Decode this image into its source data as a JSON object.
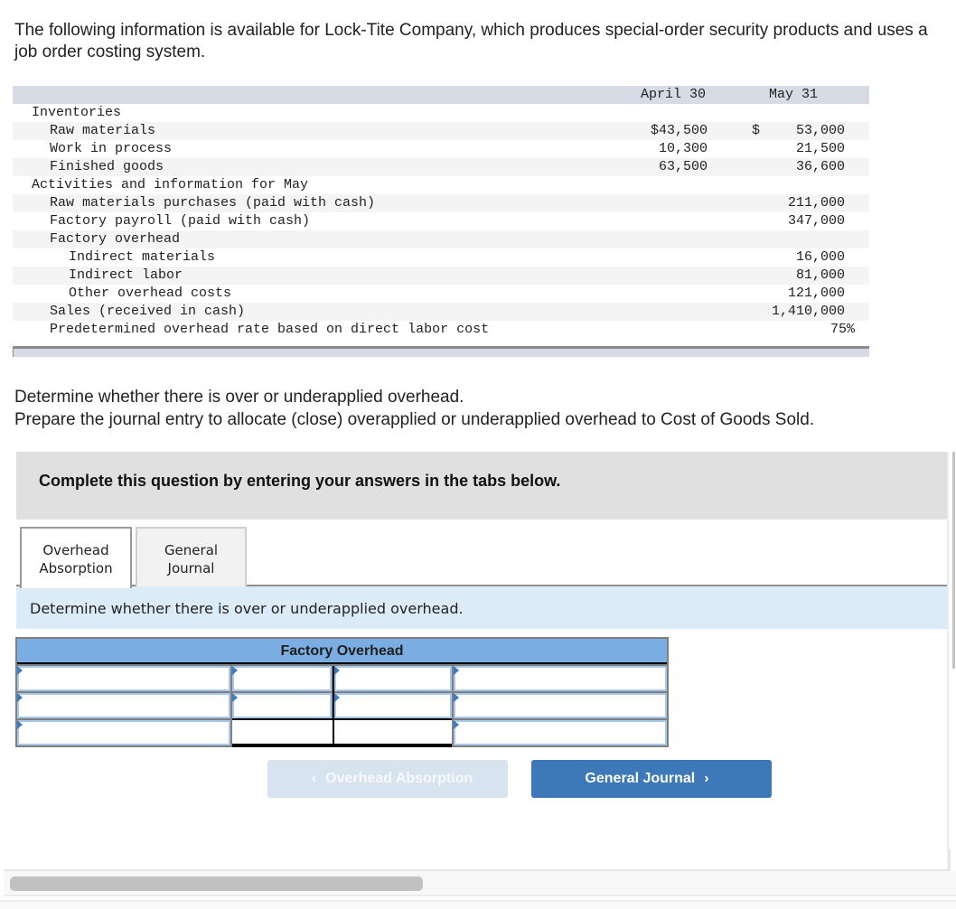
{
  "intro": "The following information is available for Lock-Tite Company, which produces special-order security products and uses a job order costing system.",
  "table": {
    "columns": [
      "April 30",
      "May 31"
    ],
    "rows": [
      {
        "label": "Inventories",
        "indent": 0,
        "april": "",
        "may_currency": "",
        "may": ""
      },
      {
        "label": "Raw materials",
        "indent": 1,
        "april": "$43,500",
        "may_currency": "$",
        "may": "53,000"
      },
      {
        "label": "Work in process",
        "indent": 1,
        "april": "10,300",
        "may_currency": "",
        "may": "21,500"
      },
      {
        "label": "Finished goods",
        "indent": 1,
        "april": "63,500",
        "may_currency": "",
        "may": "36,600"
      },
      {
        "label": "Activities and information for May",
        "indent": 0,
        "april": "",
        "may_currency": "",
        "may": ""
      },
      {
        "label": "Raw materials purchases (paid with cash)",
        "indent": 1,
        "april": "",
        "may_currency": "",
        "may": "211,000"
      },
      {
        "label": "Factory payroll (paid with cash)",
        "indent": 1,
        "april": "",
        "may_currency": "",
        "may": "347,000"
      },
      {
        "label": "Factory overhead",
        "indent": 1,
        "april": "",
        "may_currency": "",
        "may": ""
      },
      {
        "label": "Indirect materials",
        "indent": 2,
        "april": "",
        "may_currency": "",
        "may": "16,000"
      },
      {
        "label": "Indirect labor",
        "indent": 2,
        "april": "",
        "may_currency": "",
        "may": "81,000"
      },
      {
        "label": "Other overhead costs",
        "indent": 2,
        "april": "",
        "may_currency": "",
        "may": "121,000"
      },
      {
        "label": "Sales (received in cash)",
        "indent": 1,
        "april": "",
        "may_currency": "",
        "may": "1,410,000"
      },
      {
        "label": "Predetermined overhead rate based on direct labor cost",
        "indent": 1,
        "april": "",
        "may_currency": "",
        "may": "75%"
      }
    ]
  },
  "instructions": {
    "line1": "Determine whether there is over or underapplied overhead.",
    "line2": "Prepare the journal entry to allocate (close) overapplied or underapplied overhead to Cost of Goods Sold."
  },
  "banner": "Complete this question by entering your answers in the tabs below.",
  "tabs": [
    {
      "line1": "Overhead",
      "line2": "Absorption",
      "active": true
    },
    {
      "line1": "General",
      "line2": "Journal",
      "active": false
    }
  ],
  "tab_panel": {
    "prompt": "Determine whether there is over or underapplied overhead."
  },
  "t_account": {
    "title": "Factory Overhead",
    "rows": [
      {
        "left_label": "",
        "left_amount": "",
        "right_amount": "",
        "right_label": ""
      },
      {
        "left_label": "",
        "left_amount": "",
        "right_amount": "",
        "right_label": ""
      },
      {
        "left_label": "",
        "right_label": ""
      }
    ]
  },
  "nav": {
    "prev_label": "Overhead Absorption",
    "next_label": "General Journal",
    "prev_icon": "‹",
    "next_icon": "›"
  }
}
